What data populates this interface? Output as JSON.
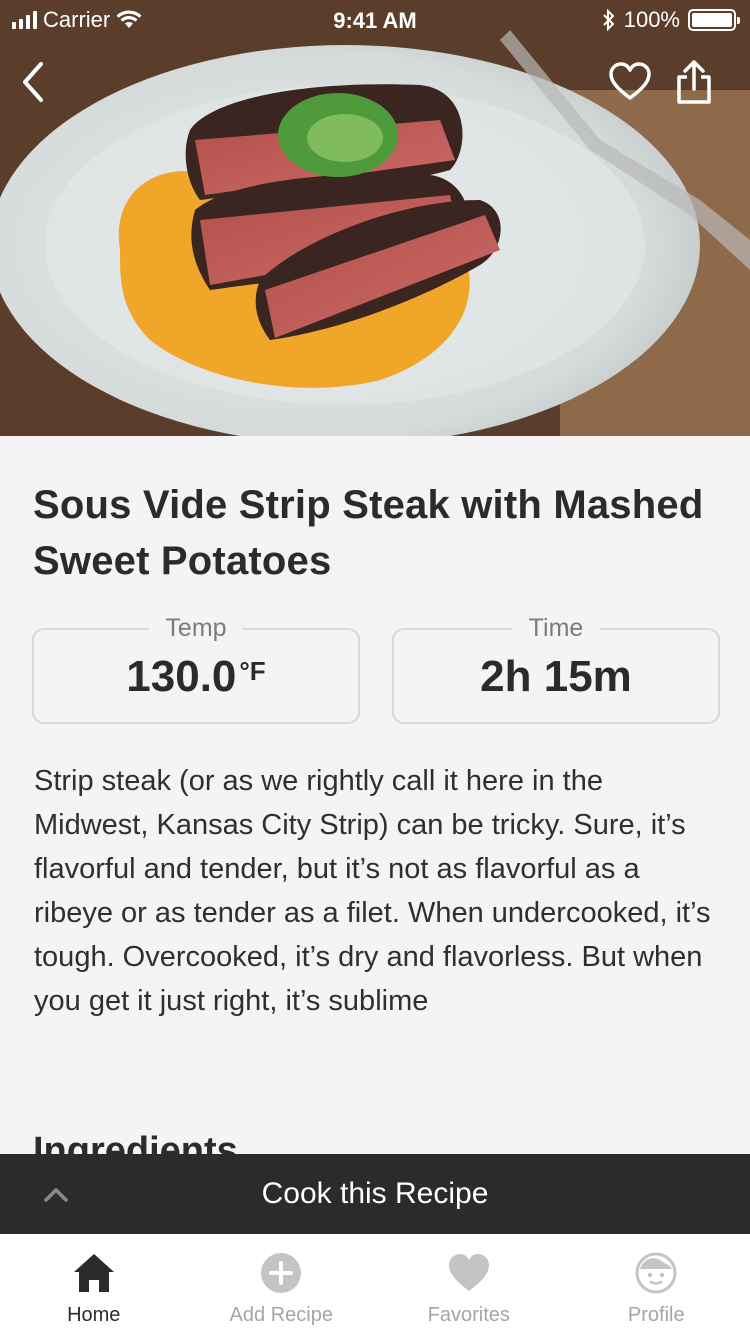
{
  "status_bar": {
    "carrier": "Carrier",
    "time": "9:41 AM",
    "battery": "100%"
  },
  "hero": {
    "image_icon": "steak-photo"
  },
  "recipe": {
    "title": "Sous Vide Strip Steak with Mashed Sweet Potatoes",
    "temp_label": "Temp",
    "temp_value": "130.0",
    "temp_unit": "°F",
    "time_label": "Time",
    "time_value": "2h 15m",
    "description": "Strip steak (or as we rightly call it here in the Midwest, Kansas City Strip) can be tricky. Sure, it’s flavorful and tender, but it’s not as flavorful as a ribeye or as tender as a filet. When undercooked, it’s tough. Overcooked, it’s dry and flavorless. But when you get it just right, it’s sublime",
    "ingredients_heading": "Ingredients"
  },
  "cook_bar": {
    "label": "Cook this Recipe"
  },
  "tabs": [
    {
      "label": "Home",
      "icon": "home-icon",
      "active": true
    },
    {
      "label": "Add Recipe",
      "icon": "plus-icon",
      "active": false
    },
    {
      "label": "Favorites",
      "icon": "heart-icon",
      "active": false
    },
    {
      "label": "Profile",
      "icon": "face-icon",
      "active": false
    }
  ],
  "colors": {
    "dark_bar": "#2b2b2b",
    "background": "#f4f4f4",
    "inactive_tab": "#a5a5a5"
  }
}
